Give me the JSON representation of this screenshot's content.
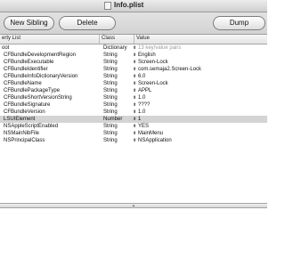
{
  "window": {
    "title": "Info.plist"
  },
  "toolbar": {
    "new_sibling_label": "New Sibling",
    "delete_label": "Delete",
    "dump_label": "Dump"
  },
  "columns": {
    "property": "erty List",
    "class": "Class",
    "value": "Value"
  },
  "rows": [
    {
      "key": "oot",
      "class": "Dictionary",
      "value": "13 key/value pairs",
      "muted": true
    },
    {
      "key": "CFBundleDevelopmentRegion",
      "class": "String",
      "value": "English"
    },
    {
      "key": "CFBundleExecutable",
      "class": "String",
      "value": "Screen-Lock"
    },
    {
      "key": "CFBundleIdentifier",
      "class": "String",
      "value": "com.semaja2.Screen-Lock"
    },
    {
      "key": "CFBundleInfoDictionaryVersion",
      "class": "String",
      "value": "6.0"
    },
    {
      "key": "CFBundleName",
      "class": "String",
      "value": "Screen-Lock"
    },
    {
      "key": "CFBundlePackageType",
      "class": "String",
      "value": "APPL"
    },
    {
      "key": "CFBundleShortVersionString",
      "class": "String",
      "value": "1.0"
    },
    {
      "key": "CFBundleSignature",
      "class": "String",
      "value": "????"
    },
    {
      "key": "CFBundleVersion",
      "class": "String",
      "value": "1.0"
    },
    {
      "key": "LSUIElement",
      "class": "Number",
      "value": "1",
      "selected": true
    },
    {
      "key": "NSAppleScriptEnabled",
      "class": "String",
      "value": "YES"
    },
    {
      "key": "NSMainNibFile",
      "class": "String",
      "value": "MainMenu"
    },
    {
      "key": "NSPrincipalClass",
      "class": "String",
      "value": "NSApplication"
    }
  ],
  "colors": {
    "selected_row": "#d4d4d4",
    "muted_value": "#9a9a9a"
  }
}
